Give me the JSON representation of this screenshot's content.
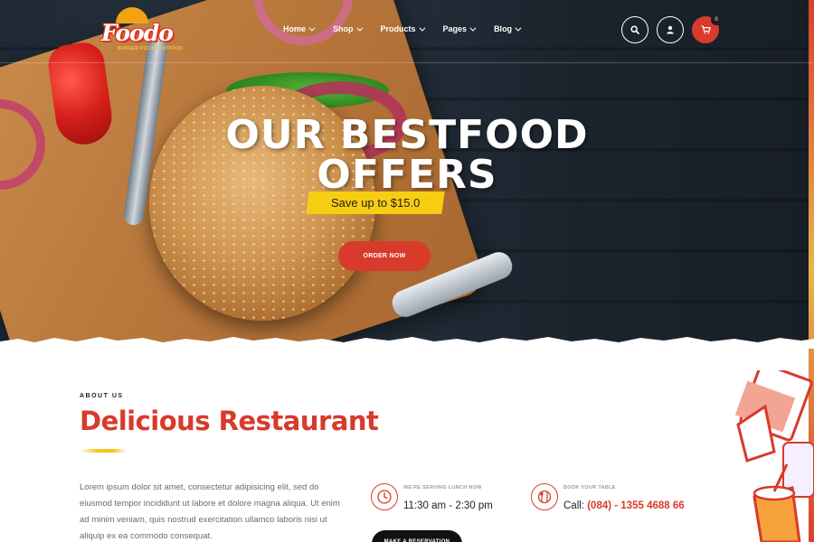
{
  "brand": {
    "logo_text": "Foodo",
    "logo_tagline": "BURGER PIZZA FASTFOOD"
  },
  "nav": {
    "items": [
      {
        "label": "Home"
      },
      {
        "label": "Shop"
      },
      {
        "label": "Products"
      },
      {
        "label": "Pages"
      },
      {
        "label": "Blog"
      }
    ],
    "icons": [
      "search-icon",
      "user-icon",
      "cart-icon"
    ],
    "cart_count": "0"
  },
  "hero": {
    "title_line1": "OUR BESTFOOD",
    "title_line2": "OFFERS",
    "ribbon_text": "Save up to $15.0",
    "cta_label": "ORDER NOW"
  },
  "about": {
    "eyebrow": "ABOUT US",
    "title": "Delicious Restaurant",
    "body": "Lorem ipsum dolor sit amet, consectetur adipisicing elit, sed do eiusmod tempor incididunt ut labore et dolore magna aliqua. Ut enim ad minim veniam, quis nostrud exercitation ullamco laboris nisi ut aliquip ex ea commodo consequat.",
    "lunch_label": "WE'RE SERVING LUNCH NOW",
    "lunch_hours": "11:30 am - 2:30 pm",
    "book_label": "BOOK YOUR TABLE",
    "call_prefix": "Call:",
    "phone": "(084) - 1355 4688 66",
    "reserve_label": "MAKE A RESERVATION"
  },
  "colors": {
    "accent_red": "#d83a2b",
    "accent_yellow": "#f7cd13",
    "dark": "#1d1d1d"
  }
}
